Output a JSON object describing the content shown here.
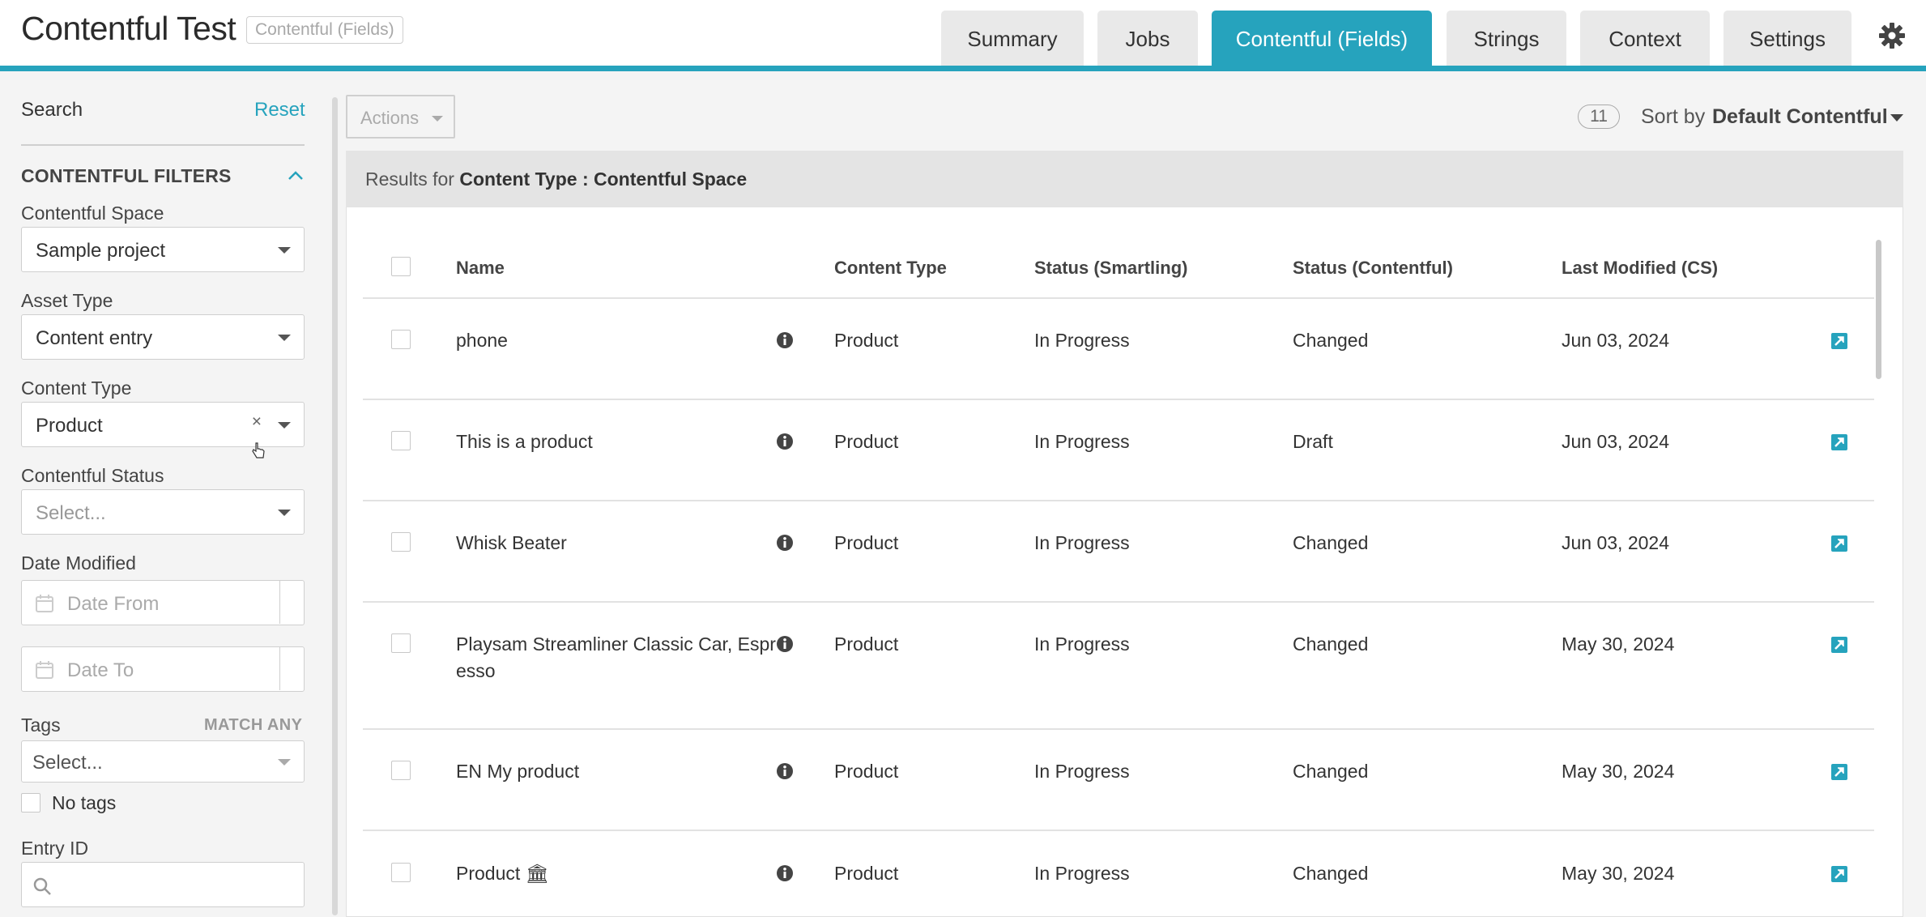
{
  "header": {
    "title": "Contentful Test",
    "badge": "Contentful (Fields)",
    "tabs": [
      {
        "label": "Summary",
        "active": false
      },
      {
        "label": "Jobs",
        "active": false
      },
      {
        "label": "Contentful (Fields)",
        "active": true
      },
      {
        "label": "Strings",
        "active": false
      },
      {
        "label": "Context",
        "active": false
      },
      {
        "label": "Settings",
        "active": false
      }
    ],
    "settings_icon": "gear-icon",
    "accent_color": "#26a3bd"
  },
  "sidebar": {
    "search_label": "Search",
    "reset_label": "Reset",
    "section_title": "CONTENTFUL FILTERS",
    "filters": {
      "space": {
        "label": "Contentful Space",
        "value": "Sample project"
      },
      "asset_type": {
        "label": "Asset Type",
        "value": "Content entry"
      },
      "content_type": {
        "label": "Content Type",
        "value": "Product",
        "clear": "×"
      },
      "status": {
        "label": "Contentful Status",
        "placeholder": "Select..."
      },
      "date_modified": {
        "label": "Date Modified",
        "from_placeholder": "Date From",
        "to_placeholder": "Date To"
      },
      "tags": {
        "label": "Tags",
        "match_label": "MATCH ANY",
        "placeholder": "Select...",
        "no_tags_label": "No tags"
      },
      "entry_id": {
        "label": "Entry ID",
        "placeholder": ""
      }
    }
  },
  "toolbar": {
    "actions_label": "Actions",
    "count": "11",
    "sort_label": "Sort by",
    "sort_value": "Default Contentful"
  },
  "results": {
    "prefix": "Results for",
    "filter_name": "Content Type",
    "separator": ":",
    "filter_value": "Contentful Space"
  },
  "table": {
    "columns": [
      "Name",
      "Content Type",
      "Status (Smartling)",
      "Status (Contentful)",
      "Last Modified (CS)"
    ],
    "rows": [
      {
        "name": "phone",
        "name2": "",
        "content_type": "Product",
        "status_smartling": "In Progress",
        "status_contentful": "Changed",
        "last_modified": "Jun 03, 2024"
      },
      {
        "name": "This is a product",
        "name2": "",
        "content_type": "Product",
        "status_smartling": "In Progress",
        "status_contentful": "Draft",
        "last_modified": "Jun 03, 2024"
      },
      {
        "name": "Whisk Beater",
        "name2": "",
        "content_type": "Product",
        "status_smartling": "In Progress",
        "status_contentful": "Changed",
        "last_modified": "Jun 03, 2024"
      },
      {
        "name": "Playsam Streamliner Classic Car, Espr",
        "name2": "esso",
        "content_type": "Product",
        "status_smartling": "In Progress",
        "status_contentful": "Changed",
        "last_modified": "May 30, 2024"
      },
      {
        "name": "EN My product",
        "name2": "",
        "content_type": "Product",
        "status_smartling": "In Progress",
        "status_contentful": "Changed",
        "last_modified": "May 30, 2024"
      },
      {
        "name": "Product 🏛",
        "name2": "",
        "content_type": "Product",
        "status_smartling": "In Progress",
        "status_contentful": "Changed",
        "last_modified": "May 30, 2024"
      }
    ]
  }
}
